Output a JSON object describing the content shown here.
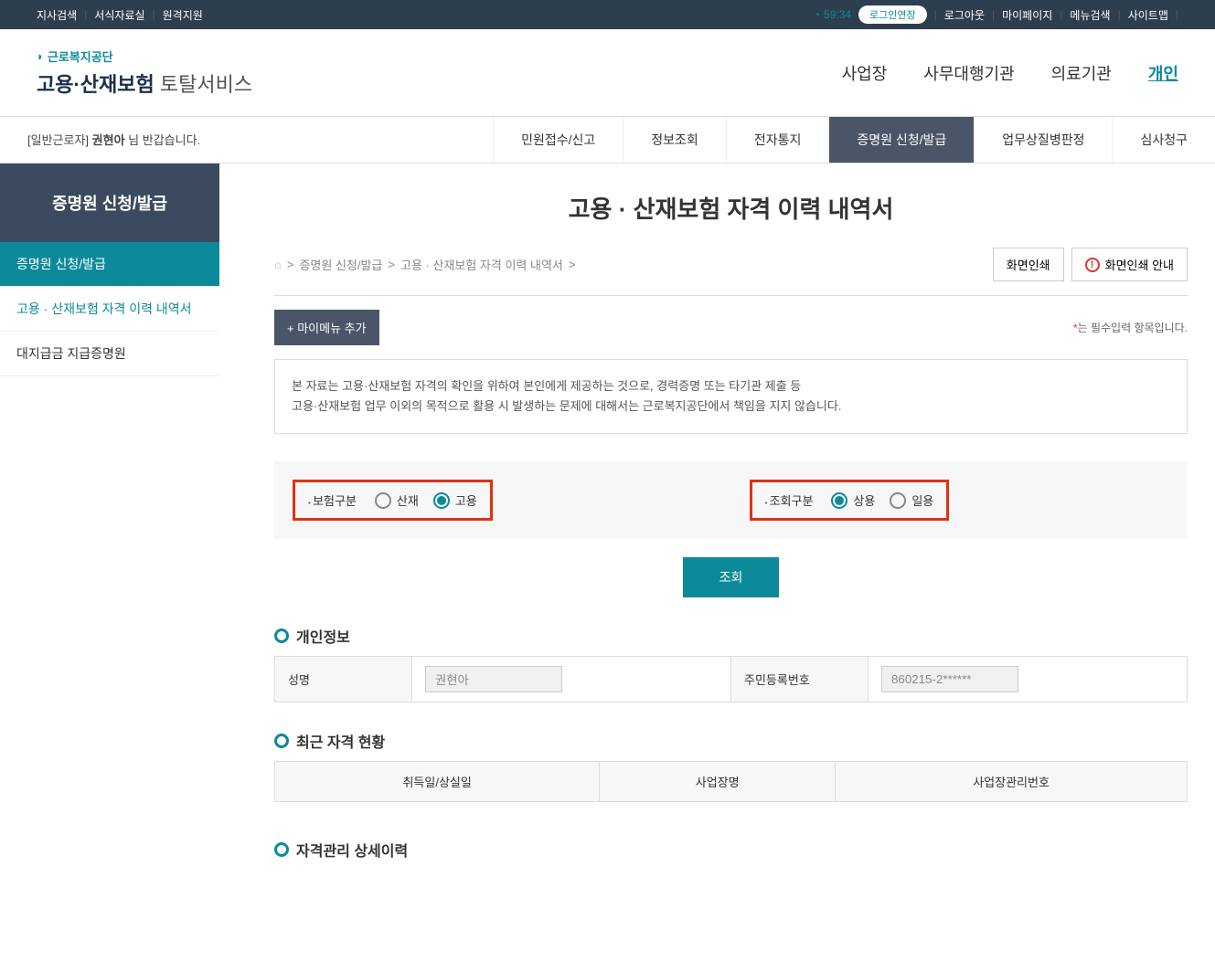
{
  "topNav": {
    "left": [
      "지사검색",
      "서식자료실",
      "원격지원"
    ],
    "timer": "59:34",
    "loginExtend": "로그인연장",
    "right": [
      "로그아웃",
      "마이페이지",
      "메뉴검색",
      "사이트맵"
    ]
  },
  "logo": {
    "org": "근로복지공단",
    "service1": "고용·산재보험",
    "service2": "토탈서비스"
  },
  "mainNav": [
    "사업장",
    "사무대행기관",
    "의료기관",
    "개인"
  ],
  "welcome": {
    "prefix": "[일반근로자]",
    "name": "권현아",
    "suffix": "님 반갑습니다."
  },
  "subNav": [
    "민원접수/신고",
    "정보조회",
    "전자통지",
    "증명원 신청/발급",
    "업무상질병판정",
    "심사청구"
  ],
  "sidebar": {
    "title": "증명원 신청/발급",
    "items": [
      "증명원 신청/발급",
      "고용 · 산재보험 자격 이력 내역서",
      "대지급금 지급증명원"
    ]
  },
  "page": {
    "title": "고용 · 산재보험 자격 이력 내역서",
    "breadcrumb": [
      "증명원 신청/발급",
      "고용 · 산재보험 자격 이력 내역서"
    ],
    "printBtn": "화면인쇄",
    "printGuideBtn": "화면인쇄 안내",
    "myMenuBtn": "마이메뉴 추가",
    "requiredNote": "는 필수입력 항목입니다.",
    "notice1": "본 자료는 고용·산재보험 자격의 확인을 위하여 본인에게 제공하는 것으로, 경력증명 또는 타기관 제출 등",
    "notice2": "고용·산재보험 업무 이외의 목적으로 활용 시 발생하는 문제에 대해서는 근로복지공단에서 책임을 지지 않습니다.",
    "filter1": {
      "label": "보험구분",
      "opt1": "산재",
      "opt2": "고용"
    },
    "filter2": {
      "label": "조회구분",
      "opt1": "상용",
      "opt2": "일용"
    },
    "searchBtn": "조회",
    "section1": "개인정보",
    "info": {
      "nameLabel": "성명",
      "nameValue": "권현아",
      "rrnLabel": "주민등록번호",
      "rrnValue": "860215-2******"
    },
    "section2": "최근 자격 현황",
    "table2cols": [
      "취득일/상실일",
      "사업장명",
      "사업장관리번호"
    ],
    "section3": "자격관리 상세이력"
  }
}
